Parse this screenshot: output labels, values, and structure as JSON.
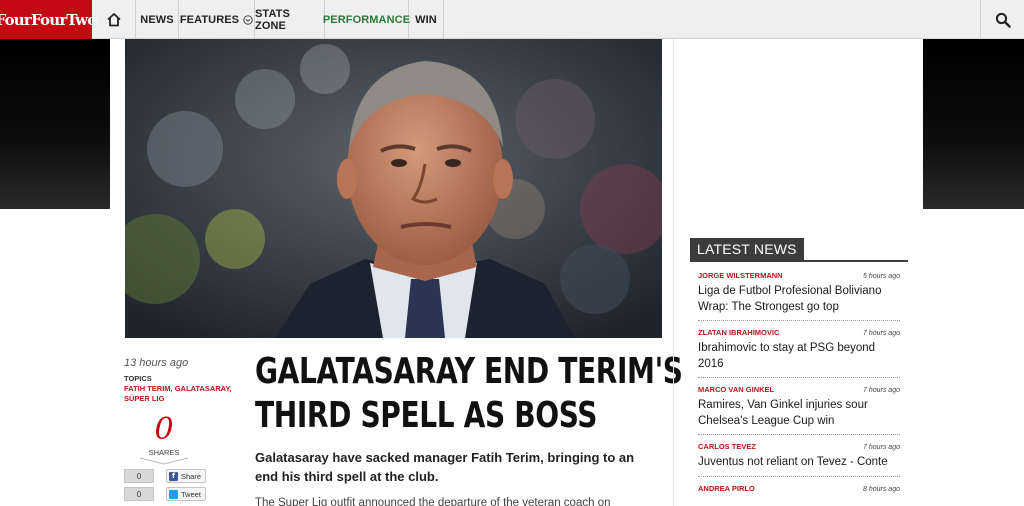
{
  "header": {
    "logo_text": "FourFourTwo",
    "nav": [
      "NEWS",
      "FEATURES",
      "STATS ZONE",
      "PERFORMANCE",
      "WIN"
    ]
  },
  "colors": {
    "brand_red": "#c30a12",
    "performance_green": "#2e7a39",
    "topic_red": "#b5161d",
    "nav_bg": "#efefef"
  },
  "icons": {
    "home": "home-icon",
    "features_dropdown": "chevron-down-circle-icon",
    "search": "search-icon",
    "facebook": "facebook-icon",
    "twitter": "twitter-icon"
  },
  "article": {
    "time": "13 hours ago",
    "topics_label": "TOPICS",
    "topics": "FATIH TERIM, GALATASARAY, SÜPER LIG",
    "shares": "0",
    "shares_label": "SHARES",
    "facebook_count": "0",
    "facebook_label": "Share",
    "twitter_count": "0",
    "twitter_label": "Tweet",
    "title_line1": "GALATASARAY END TERIM'S",
    "title_line2": "THIRD SPELL AS BOSS",
    "standfirst": "Galatasaray have sacked manager Fatih Terim, bringing to an end his third spell at the club.",
    "body": "The Super Lig outfit announced the departure of the veteran coach on Tuesday."
  },
  "sidebar": {
    "title": "LATEST NEWS",
    "items": [
      {
        "tag": "JORGE WILSTERMANN",
        "time": "5 hours ago",
        "title": "Liga de Futbol Profesional Boliviano Wrap: The Strongest go top"
      },
      {
        "tag": "ZLATAN IBRAHIMOVIC",
        "time": "7 hours ago",
        "title": "Ibrahimovic to stay at PSG beyond 2016"
      },
      {
        "tag": "MARCO VAN GINKEL",
        "time": "7 hours ago",
        "title": "Ramires, Van Ginkel injuries sour Chelsea's League Cup win"
      },
      {
        "tag": "CARLOS TEVEZ",
        "time": "7 hours ago",
        "title": "Juventus not reliant on Tevez - Conte"
      },
      {
        "tag": "ANDREA PIRLO",
        "time": "8 hours ago",
        "title": ""
      }
    ]
  }
}
